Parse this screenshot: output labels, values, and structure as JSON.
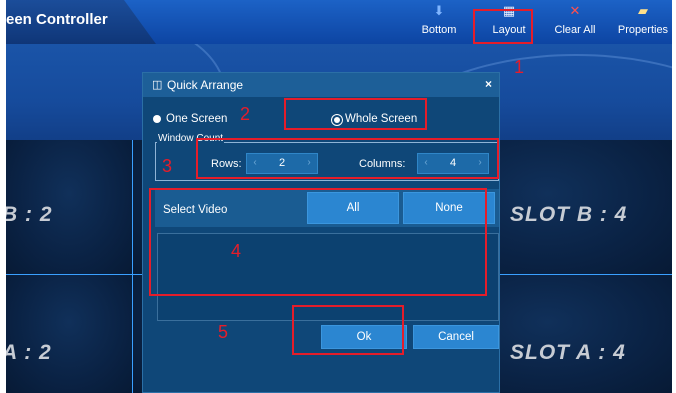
{
  "app": {
    "title_visible": "een Controller"
  },
  "toolbar": {
    "items": [
      {
        "label": "Bottom",
        "icon": "send-to-bottom-icon"
      },
      {
        "label": "Layout",
        "icon": "layout-icon"
      },
      {
        "label": "Clear All",
        "icon": "close-icon"
      },
      {
        "label": "Properties",
        "icon": "properties-icon"
      }
    ]
  },
  "background": {
    "slots": {
      "top_left": "B : 2",
      "top_right": "SLOT B : 4",
      "bottom_left": "A : 2",
      "bottom_right": "SLOT A : 4"
    }
  },
  "dialog": {
    "title": "Quick Arrange",
    "close_glyph": "×",
    "mode": {
      "one_screen": "One Screen",
      "whole_screen": "Whole Screen",
      "selected": "Whole Screen"
    },
    "window_count": {
      "legend": "Window Count",
      "rows_label": "Rows:",
      "rows_value": "2",
      "columns_label": "Columns:",
      "columns_value": "4"
    },
    "select_video": {
      "label": "Select Video",
      "all_button": "All",
      "none_button": "None"
    },
    "ok_button": "Ok",
    "cancel_button": "Cancel"
  },
  "annotations": {
    "color": "#e51d2a",
    "numbers": [
      "1",
      "2",
      "3",
      "4",
      "5"
    ]
  },
  "colors": {
    "toolbar": "#1c62c6",
    "dialog_bg": "#0f4778",
    "button": "#2b86d1",
    "grid_line": "#3aa0ff",
    "callout": "#e51d2a"
  }
}
